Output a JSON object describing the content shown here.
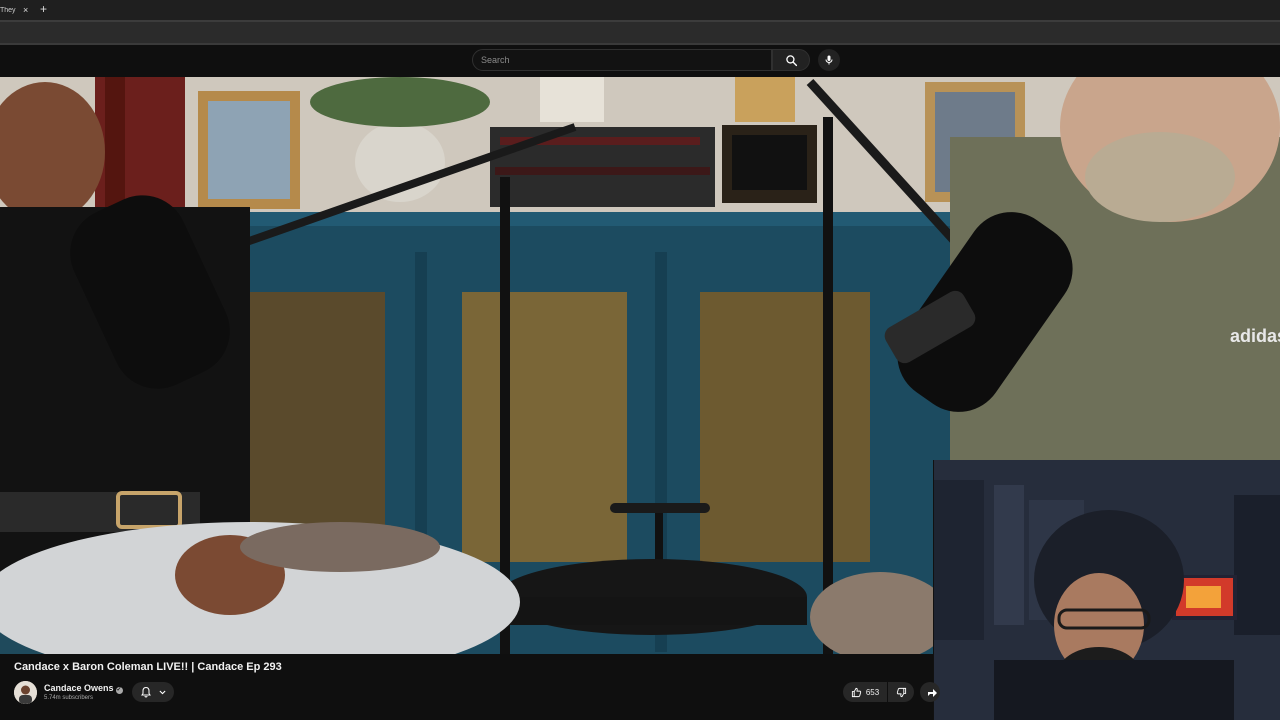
{
  "browser": {
    "tab": {
      "title": "They",
      "close_glyph": "×"
    },
    "new_tab_glyph": "+"
  },
  "masthead": {
    "search": {
      "placeholder": "Search",
      "value": ""
    },
    "icons": [
      "search-icon",
      "microphone-icon"
    ]
  },
  "video": {
    "title": "Candace x Baron Coleman LIVE!! | Candace Ep 293",
    "channel": {
      "name": "Candace Owens",
      "verified_glyph": "✓",
      "subscribers": "5.74m subscribers"
    },
    "actions": {
      "like_count": "653",
      "icons": [
        "bell-icon",
        "chevron-down-icon",
        "thumbs-up-icon",
        "thumbs-down-icon",
        "share-icon"
      ]
    }
  },
  "colors": {
    "background": "#0f0f0f",
    "button_bg": "#272727",
    "text_primary": "#f1f1f1",
    "text_secondary": "#aaaaaa"
  }
}
